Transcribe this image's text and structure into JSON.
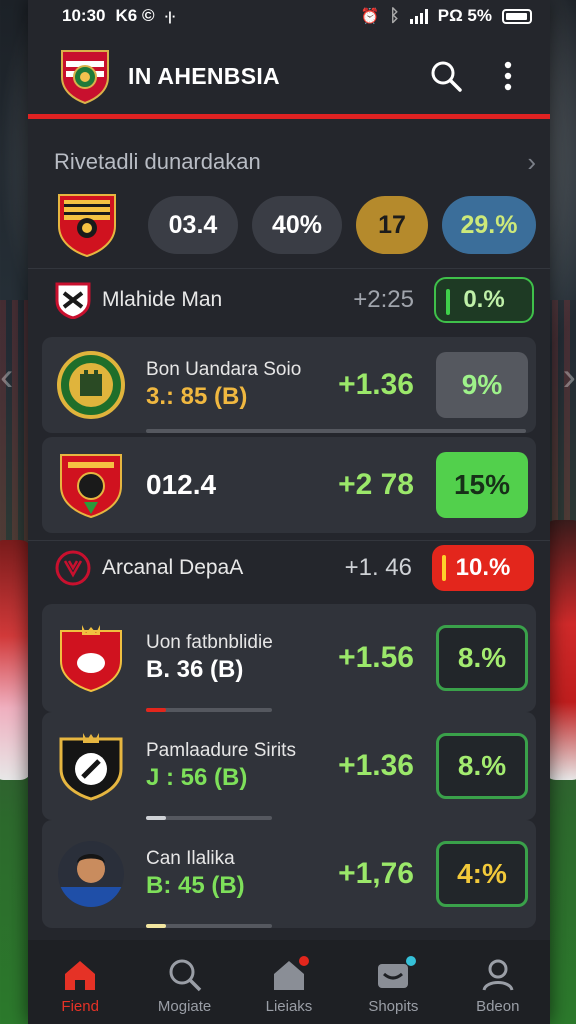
{
  "status_bar": {
    "time": "10:30",
    "glyphs": "K6 ©",
    "extra": "∙|∙",
    "alarm": "⏰",
    "bluetooth": "ᛒ",
    "battery_text": "PΩ 5%"
  },
  "header": {
    "title": "IN AHENBSIA",
    "accent": "#e02222"
  },
  "featured": {
    "title": "Rivetadli dunardakan",
    "stats": [
      "03.4",
      "40%",
      "17",
      "29.%"
    ]
  },
  "sections": [
    {
      "name": "Mlahide Man",
      "odds": "+2:25",
      "badge": "0.%",
      "matches": [
        {
          "name": "Bon Uandara Soio",
          "score": "3.: 85 (B)",
          "odds": "+1.36",
          "pct": "9%"
        },
        {
          "name": "",
          "score": "012.4",
          "odds": "+2  78",
          "pct": "15%"
        }
      ]
    },
    {
      "name": "Arcanal DepaA",
      "odds": "+1. 46",
      "badge": "10.%",
      "matches": [
        {
          "name": "Uon fatbnblidie",
          "score": "B. 36 (B)",
          "odds": "+1.56",
          "pct": "8.%"
        },
        {
          "name": "Pamlaadure Sirits",
          "score": "J : 56 (B)",
          "odds": "+1.36",
          "pct": "8.%"
        },
        {
          "name": "Can Ilalika",
          "score": "B: 45 (B)",
          "odds": "+1,76",
          "pct": "4:%"
        }
      ]
    }
  ],
  "tabs": [
    {
      "label": "Fiend",
      "icon": "home-icon"
    },
    {
      "label": "Mogiate",
      "icon": "search-icon"
    },
    {
      "label": "Lieiaks",
      "icon": "house-icon"
    },
    {
      "label": "Shopits",
      "icon": "shop-icon"
    },
    {
      "label": "Bdeon",
      "icon": "profile-icon"
    }
  ],
  "colors": {
    "green": "#52d04c",
    "red": "#e3261c",
    "gold": "#b58a2c",
    "blue": "#3b6e9a",
    "panel": "#24262c"
  }
}
